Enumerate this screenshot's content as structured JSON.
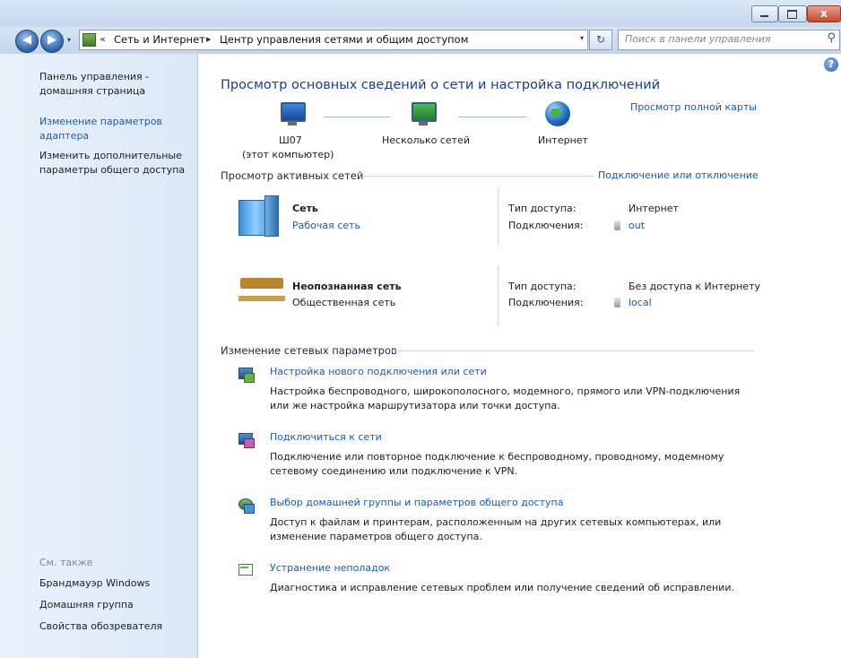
{
  "window": {
    "close_label": "x"
  },
  "nav": {
    "back": "◀",
    "forward": "▶",
    "dropdown": "▾",
    "refresh": "↻"
  },
  "address": {
    "chevron": "«",
    "crumb1": "Сеть и Интернет",
    "sep": "▸",
    "crumb2": "Центр управления сетями и общим доступом",
    "dropdown": "▾"
  },
  "search": {
    "placeholder": "Поиск в панели управления",
    "icon": "⚲"
  },
  "help": "?",
  "sidebar": {
    "home": "Панель управления - домашняя страница",
    "items": [
      "Изменение параметров адаптера",
      "Изменить дополнительные параметры общего доступа"
    ],
    "see_also": "См. также",
    "links": [
      "Брандмауэр Windows",
      "Домашняя группа",
      "Свойства обозревателя"
    ]
  },
  "main": {
    "title": "Просмотр основных сведений о сети и настройка подключений",
    "map_link": "Просмотр полной карты",
    "map": {
      "computer_name": "Ш07",
      "computer_sub": "(этот компьютер)",
      "middle": "Несколько сетей",
      "internet": "Интернет"
    },
    "active_header": "Просмотр активных сетей",
    "connect_link": "Подключение или отключение",
    "networks": [
      {
        "name": "Сеть",
        "type": "Рабочая сеть",
        "access_label": "Тип доступа:",
        "access": "Интернет",
        "conn_label": "Подключения:",
        "conn": "out"
      },
      {
        "name": "Неопознанная сеть",
        "type": "Общественная сеть",
        "access_label": "Тип доступа:",
        "access": "Без доступа к Интернету",
        "conn_label": "Подключения:",
        "conn": "local"
      }
    ],
    "change_header": "Изменение сетевых параметров",
    "tasks": [
      {
        "title": "Настройка нового подключения или сети",
        "desc1": "Настройка беспроводного, широкополосного, модемного, прямого или VPN-подключения",
        "desc2": "или же настройка маршрутизатора или точки доступа."
      },
      {
        "title": "Подключиться к сети",
        "desc1": "Подключение или повторное подключение к беспроводному, проводному, модемному",
        "desc2": "сетевому соединению или подключение к VPN."
      },
      {
        "title": "Выбор домашней группы и параметров общего доступа",
        "desc1": "Доступ к файлам и принтерам, расположенным на других сетевых компьютерах, или",
        "desc2": "изменение параметров общего доступа."
      },
      {
        "title": "Устранение неполадок",
        "desc1": "Диагностика и исправление сетевых проблем или получение сведений об исправлении.",
        "desc2": ""
      }
    ]
  }
}
